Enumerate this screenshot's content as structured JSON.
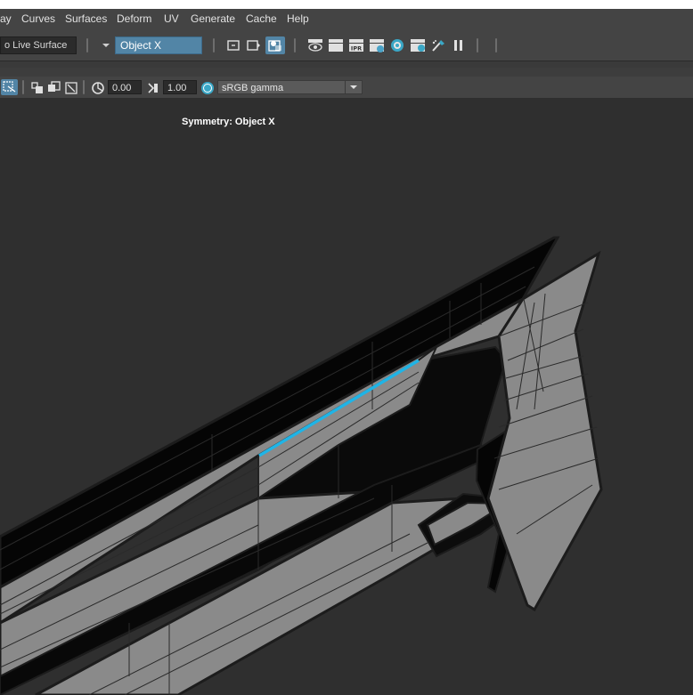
{
  "menu": {
    "items": [
      "ay",
      "Curves",
      "Surfaces",
      "Deform",
      "UV",
      "Generate",
      "Cache",
      "Help"
    ]
  },
  "statusline": {
    "live_surface_label": "o Live Surface",
    "symmetry_value": "Object X"
  },
  "panel": {
    "exposure_value": "0.00",
    "gamma_value": "1.00",
    "color_space": "sRGB gamma"
  },
  "viewport": {
    "symmetry_label": "Symmetry: Object X"
  },
  "colors": {
    "ui_bg": "#444444",
    "viewport_bg": "#2f2f2f",
    "mesh_face": "#8a8a8a",
    "mesh_dark_face": "#050505",
    "mesh_wire": "#1c1c1c",
    "selected_edge": "#1fb4e6",
    "symmetry_field": "#5285a6"
  },
  "icons": [
    "chevron-down-icon",
    "render-region-icon",
    "render-frame-icon",
    "render-settings-icon",
    "eye-render-icon",
    "clapper-icon",
    "ipr-render-icon",
    "render-setup-icon",
    "hypershade-icon",
    "playblast-icon",
    "paint-brush-icon",
    "pause-icon",
    "exposure-icon",
    "gamma-icon",
    "view-transform-icon"
  ]
}
